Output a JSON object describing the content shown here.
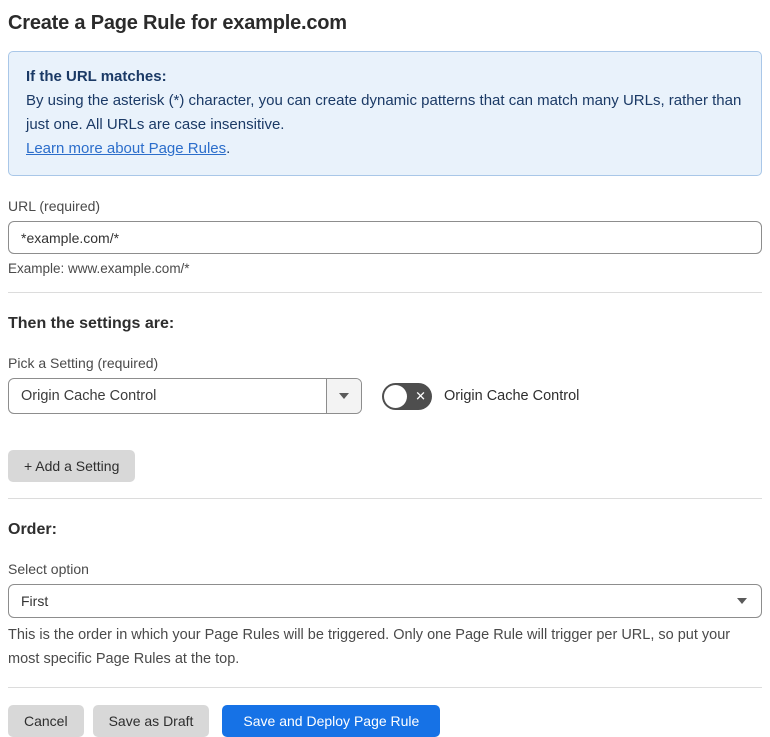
{
  "page": {
    "title": "Create a Page Rule for example.com"
  },
  "info_box": {
    "heading": "If the URL matches:",
    "body": "By using the asterisk (*) character, you can create dynamic patterns that can match many URLs, rather than just one. All URLs are case insensitive.",
    "link": "Learn more about Page Rules",
    "link_suffix": "."
  },
  "url_field": {
    "label": "URL (required)",
    "value": "*example.com/*",
    "example": "Example: www.example.com/*"
  },
  "settings_section": {
    "heading": "Then the settings are:",
    "pick_label": "Pick a Setting (required)",
    "selected_setting": "Origin Cache Control",
    "toggle": {
      "label": "Origin Cache Control",
      "state": "off"
    },
    "add_button": "+ Add a Setting"
  },
  "order_section": {
    "heading": "Order:",
    "select_label": "Select option",
    "selected_option": "First",
    "help": "This is the order in which your Page Rules will be triggered. Only one Page Rule will trigger per URL, so put your most specific Page Rules at the top."
  },
  "footer": {
    "cancel": "Cancel",
    "save_draft": "Save as Draft",
    "save_deploy": "Save and Deploy Page Rule"
  },
  "icons": {
    "toggle_x": "✕"
  },
  "colors": {
    "accent_blue": "#1672e6",
    "info_bg": "#e9f2fb",
    "info_border": "#a9c7e8",
    "info_text": "#1b3a66",
    "link_blue": "#2c6ecb",
    "toggle_off_bg": "#4e4e4e",
    "button_gray": "#d8d8d8"
  }
}
